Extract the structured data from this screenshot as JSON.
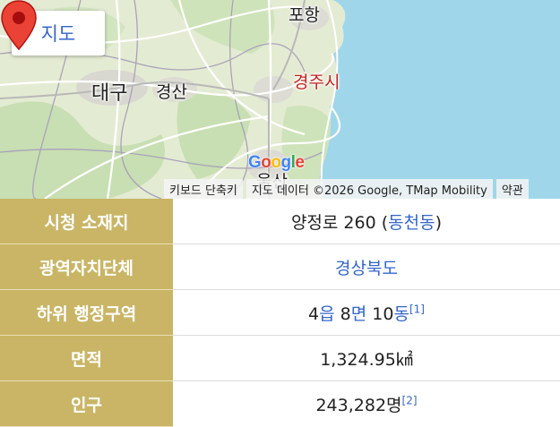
{
  "map": {
    "button_label": "지도",
    "button_icon": "external-link-icon",
    "cities": {
      "pohang": "포항",
      "daegu": "대구",
      "gyeongsan": "경산",
      "gyeongju": "경주시",
      "ulsan": "울산"
    },
    "google_logo": [
      "G",
      "o",
      "o",
      "g",
      "l",
      "e"
    ],
    "attribution": {
      "shortcuts": "키보드 단축키",
      "map_data": "지도 데이터 ©2026 Google, TMap Mobility",
      "terms": "약관"
    },
    "marker_icon": "map-pin-icon"
  },
  "infobox": {
    "rows": [
      {
        "label": "시청 소재지",
        "value_text": "양정로 260 (",
        "value_link": "동천동",
        "value_suffix": ")"
      },
      {
        "label": "광역자치단체",
        "value_link": "경상북도"
      },
      {
        "label": "하위 행정구역",
        "parts": [
          {
            "text": "4"
          },
          {
            "link": "읍"
          },
          {
            "text": " 8"
          },
          {
            "link": "면"
          },
          {
            "text": " 10"
          },
          {
            "link": "동"
          }
        ],
        "ref": "[1]"
      },
      {
        "label": "면적",
        "value_text": "1,324.95㎢"
      },
      {
        "label": "인구",
        "value_text": "243,282명",
        "ref": "[2]"
      }
    ]
  },
  "colors": {
    "header_bg": "#c9b565",
    "link": "#3366cc",
    "sea": "#9fd6ea",
    "marker": "#ea4335"
  }
}
